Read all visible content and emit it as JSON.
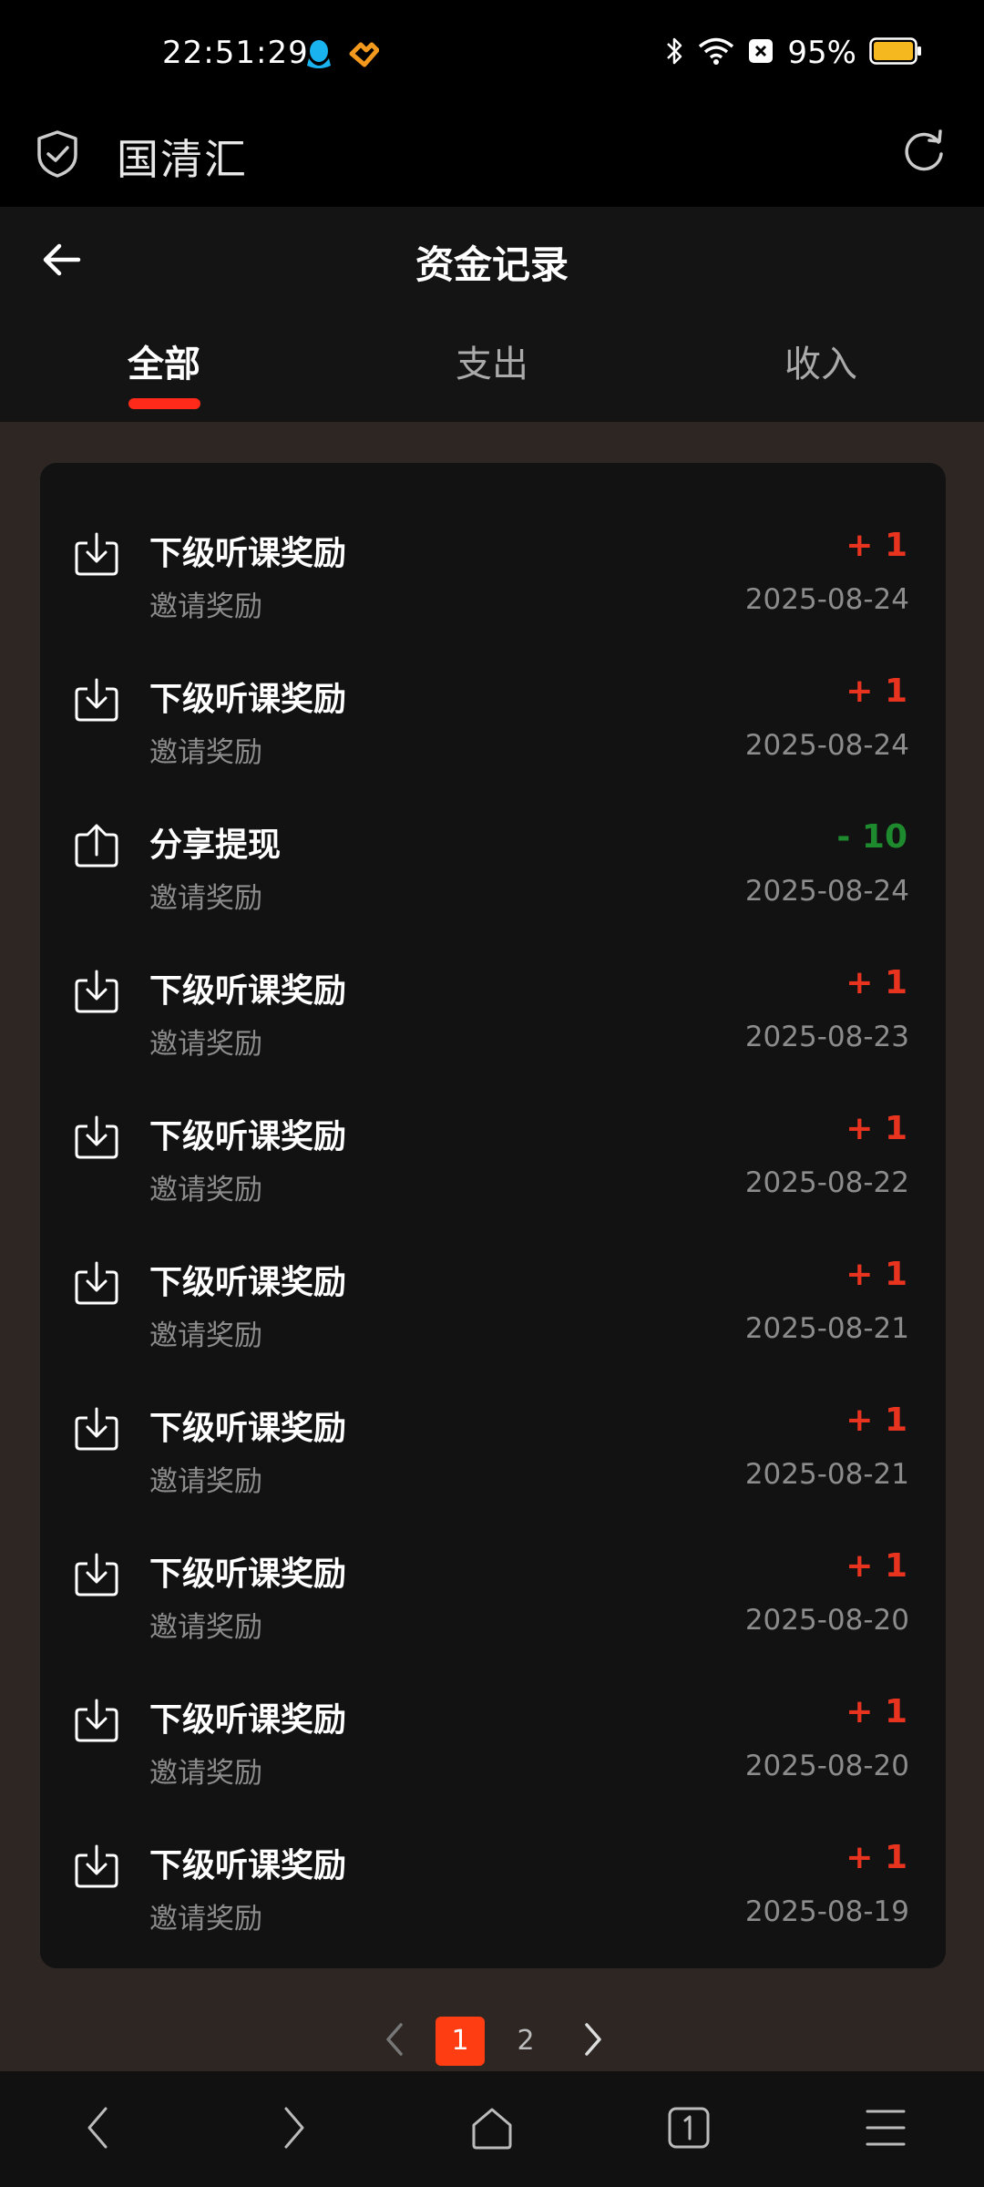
{
  "status_bar": {
    "time": "22:51:29",
    "battery_text": "95%",
    "icons": [
      "qq-icon",
      "app-heart-icon",
      "bluetooth-icon",
      "wifi-icon",
      "sim-off-icon",
      "battery-icon"
    ]
  },
  "app_bar": {
    "title": "国清汇"
  },
  "header": {
    "title": "资金记录"
  },
  "tabs": [
    {
      "label": "全部",
      "active": true
    },
    {
      "label": "支出",
      "active": false
    },
    {
      "label": "收入",
      "active": false
    }
  ],
  "records": [
    {
      "title": "下级听课奖励",
      "subtitle": "邀请奖励",
      "amount": "+ 1",
      "date": "2025-08-24",
      "type": "income"
    },
    {
      "title": "下级听课奖励",
      "subtitle": "邀请奖励",
      "amount": "+ 1",
      "date": "2025-08-24",
      "type": "income"
    },
    {
      "title": "分享提现",
      "subtitle": "邀请奖励",
      "amount": "- 10",
      "date": "2025-08-24",
      "type": "expense"
    },
    {
      "title": "下级听课奖励",
      "subtitle": "邀请奖励",
      "amount": "+ 1",
      "date": "2025-08-23",
      "type": "income"
    },
    {
      "title": "下级听课奖励",
      "subtitle": "邀请奖励",
      "amount": "+ 1",
      "date": "2025-08-22",
      "type": "income"
    },
    {
      "title": "下级听课奖励",
      "subtitle": "邀请奖励",
      "amount": "+ 1",
      "date": "2025-08-21",
      "type": "income"
    },
    {
      "title": "下级听课奖励",
      "subtitle": "邀请奖励",
      "amount": "+ 1",
      "date": "2025-08-21",
      "type": "income"
    },
    {
      "title": "下级听课奖励",
      "subtitle": "邀请奖励",
      "amount": "+ 1",
      "date": "2025-08-20",
      "type": "income"
    },
    {
      "title": "下级听课奖励",
      "subtitle": "邀请奖励",
      "amount": "+ 1",
      "date": "2025-08-20",
      "type": "income"
    },
    {
      "title": "下级听课奖励",
      "subtitle": "邀请奖励",
      "amount": "+ 1",
      "date": "2025-08-19",
      "type": "income"
    }
  ],
  "pagination": {
    "pages": [
      "1",
      "2"
    ],
    "current": "1"
  },
  "colors": {
    "accent": "#ff2a1a",
    "income": "#e8331f",
    "expense": "#1e8a2e",
    "page_active": "#ff3d12"
  }
}
